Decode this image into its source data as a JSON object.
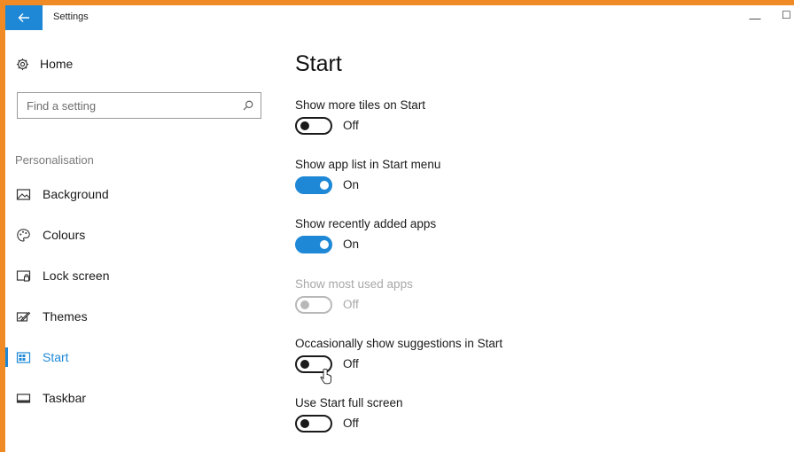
{
  "window": {
    "title": "Settings",
    "minimize_glyph": "—",
    "maximize_glyph": "☐"
  },
  "sidebar": {
    "home_label": "Home",
    "search_placeholder": "Find a setting",
    "section_label": "Personalisation",
    "items": [
      {
        "label": "Background",
        "icon": "background-icon"
      },
      {
        "label": "Colours",
        "icon": "palette-icon"
      },
      {
        "label": "Lock screen",
        "icon": "lock-screen-icon"
      },
      {
        "label": "Themes",
        "icon": "themes-icon"
      },
      {
        "label": "Start",
        "icon": "start-icon",
        "active": true
      },
      {
        "label": "Taskbar",
        "icon": "taskbar-icon"
      }
    ]
  },
  "main": {
    "title": "Start",
    "settings": [
      {
        "label": "Show more tiles on Start",
        "state": "Off",
        "on": false,
        "disabled": false
      },
      {
        "label": "Show app list in Start menu",
        "state": "On",
        "on": true,
        "disabled": false
      },
      {
        "label": "Show recently added apps",
        "state": "On",
        "on": true,
        "disabled": false
      },
      {
        "label": "Show most used apps",
        "state": "Off",
        "on": false,
        "disabled": true
      },
      {
        "label": "Occasionally show suggestions in Start",
        "state": "Off",
        "on": false,
        "disabled": false
      },
      {
        "label": "Use Start full screen",
        "state": "Off",
        "on": false,
        "disabled": false
      }
    ]
  },
  "colors": {
    "accent": "#1e88d6",
    "frame": "#f08a24",
    "disabled": "#a8a8a8"
  }
}
